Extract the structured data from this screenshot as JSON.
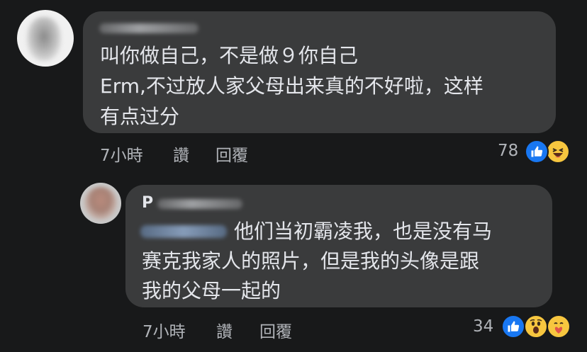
{
  "comments": [
    {
      "lines": [
        "叫你做自己，不是做９你自己",
        "Erm,不过放人家父母出来真的不好啦，这样",
        "有点过分"
      ],
      "time": "7小時",
      "like_label": "讚",
      "reply_label": "回覆",
      "reaction_count": "78",
      "reactions": [
        "like",
        "haha"
      ]
    },
    {
      "author_initial": "P",
      "lines": [
        "他们当初霸凌我，也是没有马",
        "赛克我家人的照片，但是我的头像是跟",
        "我的父母一起的"
      ],
      "time": "7小時",
      "like_label": "讚",
      "reply_label": "回覆",
      "reaction_count": "34",
      "reactions": [
        "like",
        "wow",
        "care"
      ]
    }
  ],
  "colors": {
    "background": "#18191a",
    "bubble": "#3a3b3c",
    "text": "#e4e6eb",
    "meta": "#b0b3b8",
    "like": "#1877f2",
    "emoji": "#f7c63f"
  }
}
